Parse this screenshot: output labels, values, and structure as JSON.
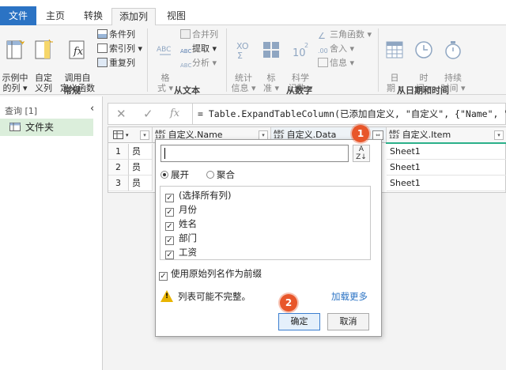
{
  "tabs": {
    "file": "文件",
    "home": "主页",
    "transform": "转换",
    "add_column": "添加列",
    "view": "视图"
  },
  "ribbon": {
    "general": {
      "group_label": "常规",
      "example": "示例中\n的列 ▾",
      "custom": "自定\n义列",
      "invoke": "调用自\n定义函数",
      "conditional": "条件列",
      "index": "索引列 ▾",
      "duplicate": "重复列"
    },
    "from_text": {
      "group_label": "从文本",
      "format": "格\n式 ▾",
      "merge": "合并列",
      "extract": "提取 ▾",
      "parse": "分析 ▾"
    },
    "from_number": {
      "group_label": "从数字",
      "stats": "统计\n信息 ▾",
      "standard": "标\n准 ▾",
      "scientific": "科学\n记数 ▾",
      "trig": "三角函数 ▾",
      "rounding": "舍入 ▾",
      "info": "信息 ▾"
    },
    "from_date": {
      "group_label": "从日期和时间",
      "date": "日\n期 ▾",
      "time": "时\n间 ▾",
      "duration": "持续\n时间 ▾"
    }
  },
  "left": {
    "header": "查询 [1]",
    "item": "文件夹"
  },
  "formula": "= Table.ExpandTableColumn(已添加自定义, \"自定义\", {\"Name\", \"Data\", \"Item\",",
  "grid": {
    "columns": [
      "自定义.Name",
      "自定义.Data",
      "自定义.Item"
    ],
    "rows": [
      {
        "num": "1",
        "c1": "员",
        "item": "Sheet1"
      },
      {
        "num": "2",
        "c1": "员",
        "item": "Sheet1"
      },
      {
        "num": "3",
        "c1": "员",
        "item": "Sheet1"
      }
    ]
  },
  "popup": {
    "search_value": "",
    "expand": "展开",
    "aggregate": "聚合",
    "columns": [
      {
        "label": "(选择所有列)",
        "checked": true
      },
      {
        "label": "月份",
        "checked": true
      },
      {
        "label": "姓名",
        "checked": true
      },
      {
        "label": "部门",
        "checked": true
      },
      {
        "label": "工资",
        "checked": true
      }
    ],
    "use_prefix": "使用原始列名作为前缀",
    "warning": "列表可能不完整。",
    "load_more": "加载更多",
    "ok": "确定",
    "cancel": "取消"
  },
  "badges": {
    "one": "1",
    "two": "2"
  },
  "colors": {
    "accent": "#2b73c4",
    "badge": "#e8562a",
    "selected_query": "#dbeedb",
    "teal_line": "#2bb08a"
  }
}
